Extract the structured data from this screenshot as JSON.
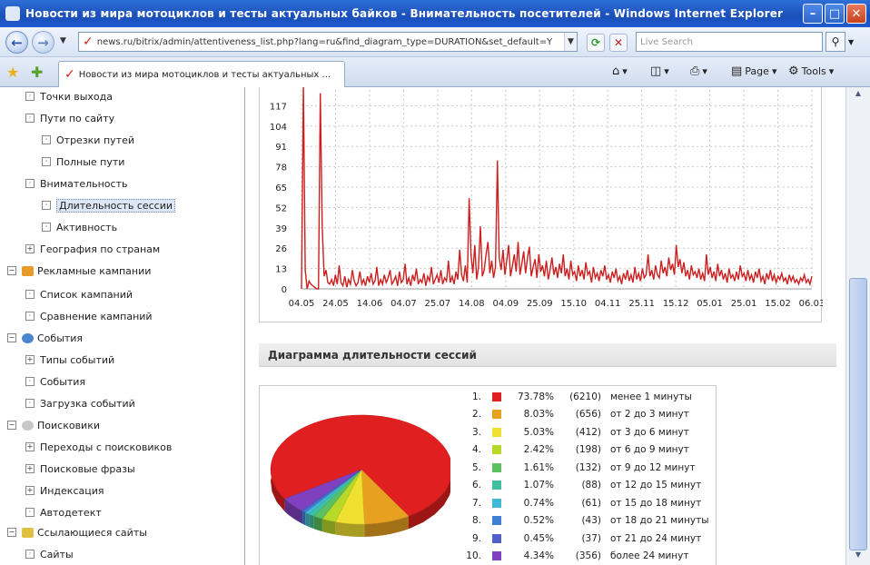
{
  "window": {
    "title": "Новости из мира мотоциклов и тесты актуальных байков - Внимательность посетителей - Windows Internet Explorer",
    "min_glyph": "–",
    "max_glyph": "□",
    "close_glyph": "✕"
  },
  "address": {
    "url": "news.ru/bitrix/admin/attentiveness_list.php?lang=ru&find_diagram_type=DURATION&set_default=Y",
    "search_placeholder": "Live Search"
  },
  "tab": {
    "label": "Новости из мира мотоциклов и тесты актуальных ..."
  },
  "commands": {
    "page": "Page",
    "tools": "Tools"
  },
  "sidebar": {
    "items": [
      {
        "label": "Точки выхода",
        "box": "·"
      },
      {
        "label": "Пути по сайту",
        "box": "·"
      },
      {
        "label": "Отрезки путей",
        "box": "·"
      },
      {
        "label": "Полные пути",
        "box": "·"
      },
      {
        "label": "Внимательность",
        "box": "·"
      },
      {
        "label": "Длительность сессии",
        "box": "·"
      },
      {
        "label": "Активность",
        "box": "·"
      },
      {
        "label": "География по странам",
        "box": "+"
      },
      {
        "label": "Рекламные кампании",
        "box": "−"
      },
      {
        "label": "Список кампаний",
        "box": "·"
      },
      {
        "label": "Сравнение кампаний",
        "box": "·"
      },
      {
        "label": "События",
        "box": "−"
      },
      {
        "label": "Типы событий",
        "box": "+"
      },
      {
        "label": "События",
        "box": "·"
      },
      {
        "label": "Загрузка событий",
        "box": "·"
      },
      {
        "label": "Поисковики",
        "box": "−"
      },
      {
        "label": "Переходы с поисковиков",
        "box": "+"
      },
      {
        "label": "Поисковые фразы",
        "box": "+"
      },
      {
        "label": "Индексация",
        "box": "+"
      },
      {
        "label": "Автодетект",
        "box": "·"
      },
      {
        "label": "Ссылающиеся сайты",
        "box": "−"
      },
      {
        "label": "Сайты",
        "box": "·"
      }
    ]
  },
  "section": {
    "title": "Диаграмма длительности сессий"
  },
  "chart_data": [
    {
      "type": "line",
      "yticks": [
        0,
        13,
        26,
        39,
        52,
        65,
        78,
        91,
        104,
        117
      ],
      "xticks": [
        "04.05",
        "24.05",
        "14.06",
        "04.07",
        "25.07",
        "14.08",
        "04.09",
        "25.09",
        "15.10",
        "04.11",
        "25.11",
        "15.12",
        "05.01",
        "25.01",
        "15.02",
        "06.03"
      ],
      "ylim": [
        0,
        130
      ],
      "grid": true,
      "color": "#cc1f1f",
      "values": [
        0,
        130,
        12,
        0,
        5,
        3,
        2,
        1,
        0,
        0,
        125,
        40,
        8,
        12,
        4,
        3,
        6,
        2,
        9,
        3,
        15,
        4,
        2,
        8,
        1,
        6,
        3,
        12,
        5,
        2,
        4,
        11,
        3,
        6,
        2,
        8,
        4,
        10,
        3,
        5,
        14,
        2,
        6,
        3,
        9,
        4,
        7,
        12,
        3,
        5,
        8,
        2,
        11,
        4,
        6,
        16,
        3,
        7,
        2,
        9,
        5,
        13,
        3,
        6,
        4,
        10,
        2,
        8,
        5,
        14,
        3,
        6,
        9,
        4,
        12,
        3,
        7,
        5,
        18,
        4,
        8,
        3,
        11,
        6,
        25,
        9,
        5,
        15,
        4,
        58,
        22,
        10,
        28,
        6,
        14,
        40,
        8,
        12,
        22,
        30,
        10,
        18,
        7,
        14,
        82,
        20,
        12,
        25,
        9,
        18,
        28,
        8,
        15,
        22,
        11,
        30,
        9,
        16,
        24,
        10,
        20,
        27,
        8,
        14,
        19,
        7,
        22,
        11,
        15,
        8,
        18,
        6,
        12,
        20,
        9,
        14,
        7,
        16,
        10,
        22,
        8,
        13,
        6,
        18,
        9,
        11,
        5,
        15,
        8,
        12,
        6,
        17,
        9,
        11,
        4,
        14,
        7,
        10,
        5,
        12,
        8,
        15,
        6,
        9,
        4,
        11,
        7,
        13,
        5,
        8,
        3,
        10,
        6,
        12,
        5,
        9,
        4,
        14,
        6,
        10,
        5,
        13,
        7,
        9,
        22,
        8,
        12,
        6,
        15,
        9,
        7,
        18,
        10,
        14,
        8,
        20,
        12,
        16,
        9,
        28,
        14,
        19,
        10,
        17,
        8,
        12,
        6,
        15,
        9,
        11,
        7,
        13,
        6,
        10,
        5,
        22,
        9,
        14,
        7,
        11,
        5,
        16,
        8,
        12,
        6,
        10,
        4,
        13,
        7,
        9,
        5,
        11,
        6,
        15,
        8,
        10,
        5,
        12,
        6,
        9,
        4,
        11,
        7,
        13,
        5,
        8,
        3,
        10,
        6,
        12,
        5,
        9,
        4,
        8,
        6,
        10,
        5,
        7,
        3,
        9,
        5,
        8,
        4,
        6,
        3,
        7,
        5,
        9,
        4,
        6,
        3,
        8
      ]
    },
    {
      "type": "pie",
      "slices": [
        {
          "index": "1.",
          "pct": "73.78%",
          "count": "(6210)",
          "range": "менее 1 минуты",
          "value": 73.78,
          "color": "#e02020"
        },
        {
          "index": "2.",
          "pct": "8.03%",
          "count": "(656)",
          "range": "от 2 до 3 минут",
          "value": 8.03,
          "color": "#e8a020"
        },
        {
          "index": "3.",
          "pct": "5.03%",
          "count": "(412)",
          "range": "от 3 до 6 минут",
          "value": 5.03,
          "color": "#f0e030"
        },
        {
          "index": "4.",
          "pct": "2.42%",
          "count": "(198)",
          "range": "от 6 до 9 минут",
          "value": 2.42,
          "color": "#b8d82a"
        },
        {
          "index": "5.",
          "pct": "1.61%",
          "count": "(132)",
          "range": "от 9 до 12 минут",
          "value": 1.61,
          "color": "#5cc060"
        },
        {
          "index": "6.",
          "pct": "1.07%",
          "count": "(88)",
          "range": "от 12 до 15 минут",
          "value": 1.07,
          "color": "#40c0a0"
        },
        {
          "index": "7.",
          "pct": "0.74%",
          "count": "(61)",
          "range": "от 15 до 18 минут",
          "value": 0.74,
          "color": "#40b8d8"
        },
        {
          "index": "8.",
          "pct": "0.52%",
          "count": "(43)",
          "range": "от 18 до 21 минуты",
          "value": 0.52,
          "color": "#4080d0"
        },
        {
          "index": "9.",
          "pct": "0.45%",
          "count": "(37)",
          "range": "от 21 до 24 минут",
          "value": 0.45,
          "color": "#5060c8"
        },
        {
          "index": "10.",
          "pct": "4.34%",
          "count": "(356)",
          "range": "более 24 минут",
          "value": 4.34,
          "color": "#8040c0"
        }
      ]
    }
  ]
}
